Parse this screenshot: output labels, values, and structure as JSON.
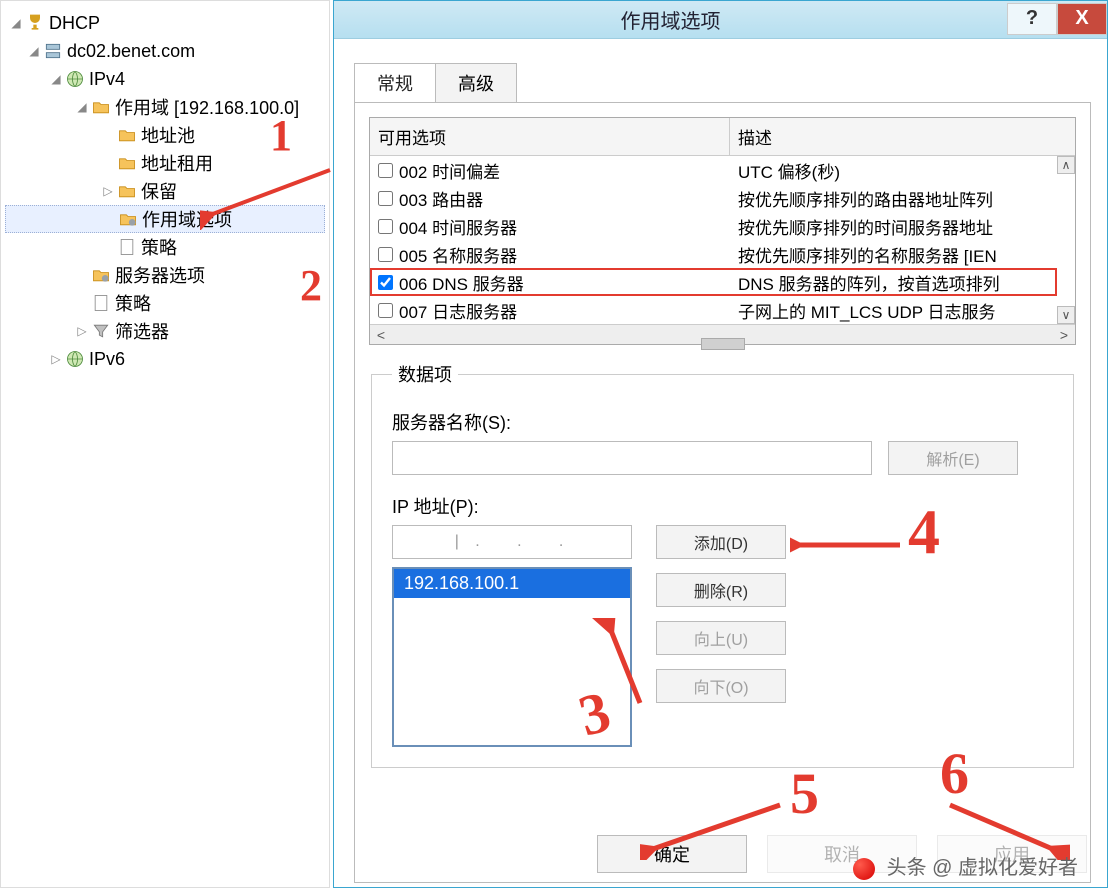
{
  "tree": {
    "root": "DHCP",
    "server": "dc02.benet.com",
    "ipv4": "IPv4",
    "scope": "作用域 [192.168.100.0]",
    "pool": "地址池",
    "lease": "地址租用",
    "reserve": "保留",
    "scopeopts": "作用域选项",
    "policy1": "策略",
    "serveropts": "服务器选项",
    "policy2": "策略",
    "filters": "筛选器",
    "ipv6": "IPv6"
  },
  "dialog": {
    "title": "作用域选项",
    "tab_general": "常规",
    "tab_advanced": "高级",
    "col_avail": "可用选项",
    "col_desc": "描述",
    "options": [
      {
        "code": "002 时间偏差",
        "desc": "UTC 偏移(秒)",
        "checked": false
      },
      {
        "code": "003 路由器",
        "desc": "按优先顺序排列的路由器地址阵列",
        "checked": false
      },
      {
        "code": "004 时间服务器",
        "desc": "按优先顺序排列的时间服务器地址",
        "checked": false
      },
      {
        "code": "005 名称服务器",
        "desc": "按优先顺序排列的名称服务器 [IEN",
        "checked": false
      },
      {
        "code": "006 DNS 服务器",
        "desc": "DNS 服务器的阵列，按首选项排列",
        "checked": true
      },
      {
        "code": "007 日志服务器",
        "desc": "子网上的 MIT_LCS UDP 日志服务",
        "checked": false
      }
    ],
    "fieldset": "数据项",
    "server_name_label": "服务器名称(S):",
    "resolve_btn": "解析(E)",
    "ip_label": "IP 地址(P):",
    "add_btn": "添加(D)",
    "remove_btn": "删除(R)",
    "up_btn": "向上(U)",
    "down_btn": "向下(O)",
    "ip_list": [
      "192.168.100.1"
    ],
    "ok_btn": "确定",
    "cancel_btn": "取消",
    "apply_btn": "应用"
  },
  "annotations": {
    "n1": "1",
    "n2": "2",
    "n3": "3",
    "n4": "4",
    "n5": "5",
    "n6": "6"
  },
  "watermark": "头条 @ 虚拟化爱好者"
}
